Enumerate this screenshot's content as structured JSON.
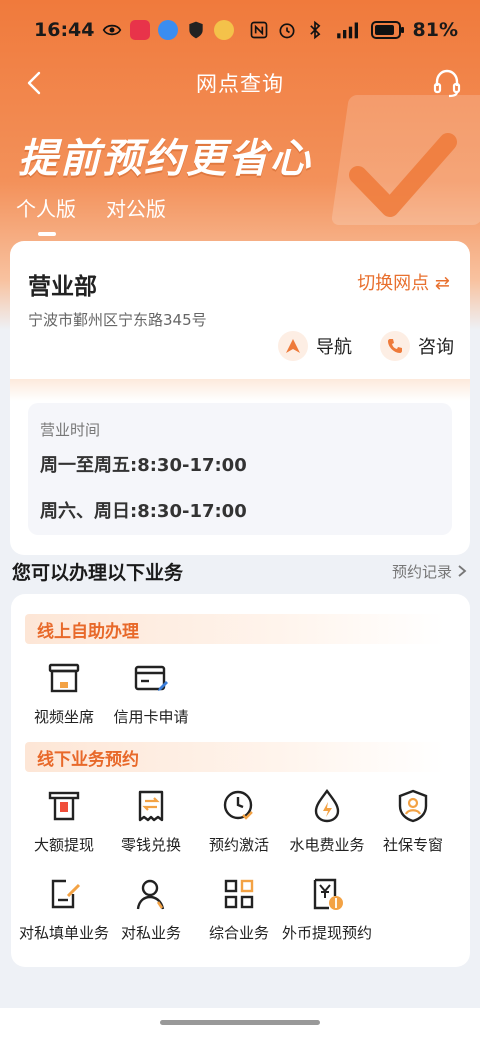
{
  "status_bar": {
    "time": "16:44",
    "battery": "81%"
  },
  "nav": {
    "title": "网点查询"
  },
  "hero": {
    "slogan": "提前预约更省心",
    "tabs": [
      {
        "label": "个人版",
        "active": true
      },
      {
        "label": "对公版",
        "active": false
      }
    ]
  },
  "branch": {
    "name": "营业部",
    "switch_label": "切换网点 ⇄",
    "address": "宁波市鄞州区宁东路345号",
    "navigate_label": "导航",
    "consult_label": "咨询",
    "hours_label": "营业时间",
    "hours_weekday": "周一至周五:8:30-17:00",
    "hours_weekend": "周六、周日:8:30-17:00"
  },
  "services": {
    "title": "您可以办理以下业务",
    "records_label": "预约记录",
    "online_section": "线上自助办理",
    "offline_section": "线下业务预约",
    "online_items": [
      {
        "label": "视频坐席",
        "icon": "video-seat-icon"
      },
      {
        "label": "信用卡申请",
        "icon": "credit-card-icon"
      }
    ],
    "offline_items": [
      {
        "label": "大额提现",
        "icon": "withdraw-icon"
      },
      {
        "label": "零钱兑换",
        "icon": "exchange-icon"
      },
      {
        "label": "预约激活",
        "icon": "clock-check-icon"
      },
      {
        "label": "水电费业务",
        "icon": "utility-drop-icon"
      },
      {
        "label": "社保专窗",
        "icon": "social-security-shield-icon"
      },
      {
        "label": "对私填单业务",
        "icon": "form-fill-icon"
      },
      {
        "label": "对私业务",
        "icon": "person-icon"
      },
      {
        "label": "综合业务",
        "icon": "grid-icon"
      },
      {
        "label": "外币提现预约",
        "icon": "foreign-currency-icon"
      }
    ]
  },
  "colors": {
    "brand": "#f07a3c",
    "accent_text": "#e8692a"
  }
}
